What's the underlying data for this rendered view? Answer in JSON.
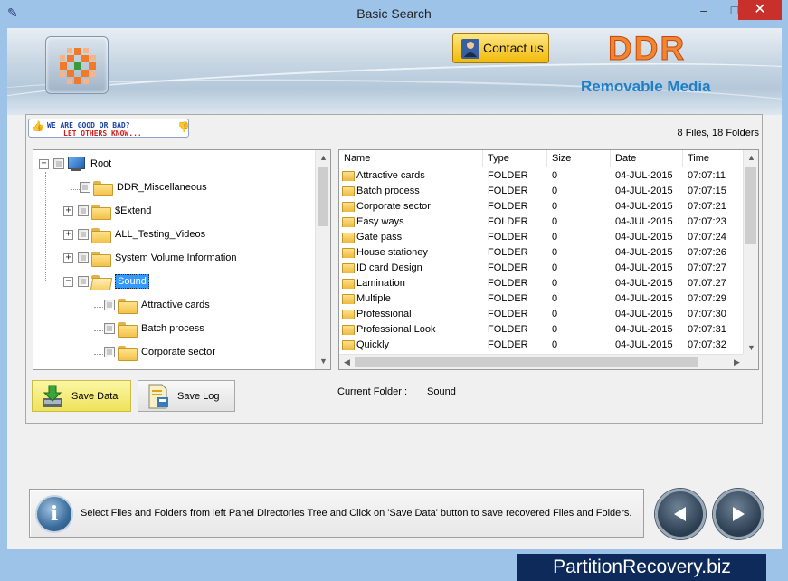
{
  "window": {
    "title": "Basic Search",
    "minimize_glyph": "–",
    "maximize_glyph": "□",
    "close_glyph": "✕"
  },
  "header": {
    "contact_label": "Contact us",
    "brand": "DDR",
    "subtitle": "Removable Media"
  },
  "feedback": {
    "line1": "WE ARE GOOD OR BAD?",
    "line2": "LET OTHERS KNOW..."
  },
  "summary": "8 Files, 18 Folders",
  "tree": {
    "items": [
      {
        "label": "Root",
        "icon": "computer-icon",
        "expander": "−",
        "level": 0
      },
      {
        "label": "DDR_Miscellaneous",
        "icon": "folder-icon",
        "expander": "",
        "level": 1
      },
      {
        "label": "$Extend",
        "icon": "folder-icon",
        "expander": "+",
        "level": 1
      },
      {
        "label": "ALL_Testing_Videos",
        "icon": "folder-icon",
        "expander": "+",
        "level": 1
      },
      {
        "label": "System Volume Information",
        "icon": "folder-icon",
        "expander": "+",
        "level": 1
      },
      {
        "label": "Sound",
        "icon": "folder-open-icon",
        "expander": "−",
        "level": 1,
        "selected": true
      },
      {
        "label": "Attractive cards",
        "icon": "folder-icon",
        "expander": "",
        "level": 2
      },
      {
        "label": "Batch process",
        "icon": "folder-icon",
        "expander": "",
        "level": 2
      },
      {
        "label": "Corporate sector",
        "icon": "folder-icon",
        "expander": "",
        "level": 2
      }
    ]
  },
  "list": {
    "columns": [
      "Name",
      "Type",
      "Size",
      "Date",
      "Time"
    ],
    "rows": [
      {
        "name": "Attractive cards",
        "type": "FOLDER",
        "size": "0",
        "date": "04-JUL-2015",
        "time": "07:07:11"
      },
      {
        "name": "Batch process",
        "type": "FOLDER",
        "size": "0",
        "date": "04-JUL-2015",
        "time": "07:07:15"
      },
      {
        "name": "Corporate sector",
        "type": "FOLDER",
        "size": "0",
        "date": "04-JUL-2015",
        "time": "07:07:21"
      },
      {
        "name": "Easy ways",
        "type": "FOLDER",
        "size": "0",
        "date": "04-JUL-2015",
        "time": "07:07:23"
      },
      {
        "name": "Gate pass",
        "type": "FOLDER",
        "size": "0",
        "date": "04-JUL-2015",
        "time": "07:07:24"
      },
      {
        "name": "House stationey",
        "type": "FOLDER",
        "size": "0",
        "date": "04-JUL-2015",
        "time": "07:07:26"
      },
      {
        "name": "ID card Design",
        "type": "FOLDER",
        "size": "0",
        "date": "04-JUL-2015",
        "time": "07:07:27"
      },
      {
        "name": "Lamination",
        "type": "FOLDER",
        "size": "0",
        "date": "04-JUL-2015",
        "time": "07:07:27"
      },
      {
        "name": "Multiple",
        "type": "FOLDER",
        "size": "0",
        "date": "04-JUL-2015",
        "time": "07:07:29"
      },
      {
        "name": "Professional",
        "type": "FOLDER",
        "size": "0",
        "date": "04-JUL-2015",
        "time": "07:07:30"
      },
      {
        "name": "Professional Look",
        "type": "FOLDER",
        "size": "0",
        "date": "04-JUL-2015",
        "time": "07:07:31"
      },
      {
        "name": "Quickly",
        "type": "FOLDER",
        "size": "0",
        "date": "04-JUL-2015",
        "time": "07:07:32"
      }
    ]
  },
  "buttons": {
    "save_data": "Save Data",
    "save_log": "Save Log"
  },
  "current_folder": {
    "label": "Current Folder :",
    "value": "Sound"
  },
  "status": {
    "info_glyph": "i",
    "text": "Select Files and Folders from left Panel Directories Tree and Click on 'Save Data' button to save recovered Files and Folders."
  },
  "watermark": "PartitionRecovery.biz",
  "colors": {
    "brand": "#f08534",
    "subtitle": "#1c7fc7",
    "selection": "#3399ff",
    "contact_button": "#f2b90a",
    "save_data_button": "#eee35c",
    "watermark_bg": "#0d2a5a"
  }
}
